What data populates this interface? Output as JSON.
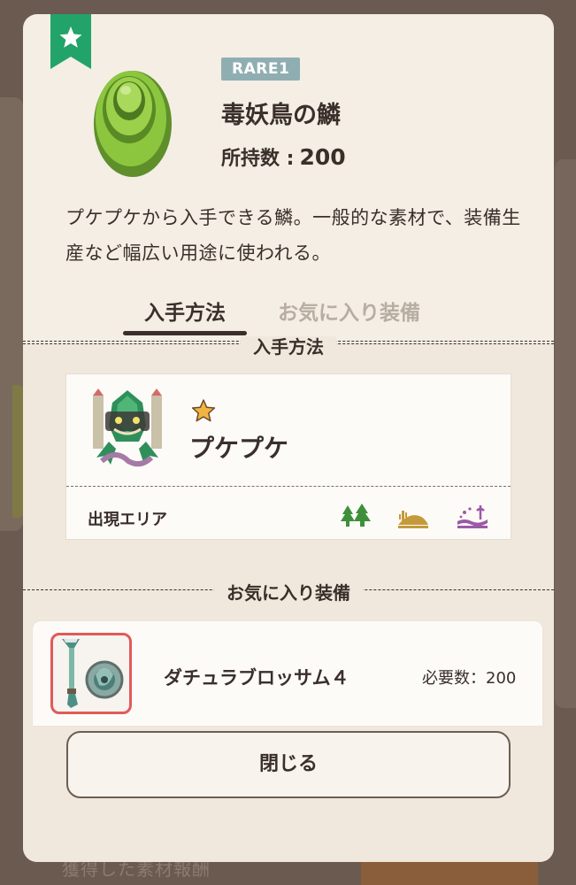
{
  "background": {
    "footer_text": "獲得した素材報酬"
  },
  "item": {
    "rarity": "RARE1",
    "name": "毒妖鳥の鱗",
    "owned_label": "所持数 :",
    "owned_count": "200",
    "description": "プケプケから入手できる鱗。一般的な素材で、装備生産など幅広い用途に使われる。",
    "favorite": true
  },
  "tabs": [
    {
      "label": "入手方法",
      "active": true
    },
    {
      "label": "お気に入り装備",
      "active": false
    }
  ],
  "source_section": {
    "title": "入手方法",
    "monster": {
      "name": "プケプケ",
      "stars": 1
    },
    "area_label": "出現エリア",
    "areas": [
      "forest-icon",
      "desert-icon",
      "swamp-icon"
    ]
  },
  "favorite_section": {
    "title": "お気に入り装備",
    "equipment": {
      "name": "ダチュラブロッサム４",
      "required_label": "必要数：200"
    }
  },
  "buttons": {
    "close": "閉じる"
  },
  "colors": {
    "rarity_badge": "#8faeb2",
    "favorite_ribbon": "#21a36a",
    "selection_border": "#e05a5a",
    "text": "#3a2f2a",
    "modal_bg": "#f4eee5"
  }
}
